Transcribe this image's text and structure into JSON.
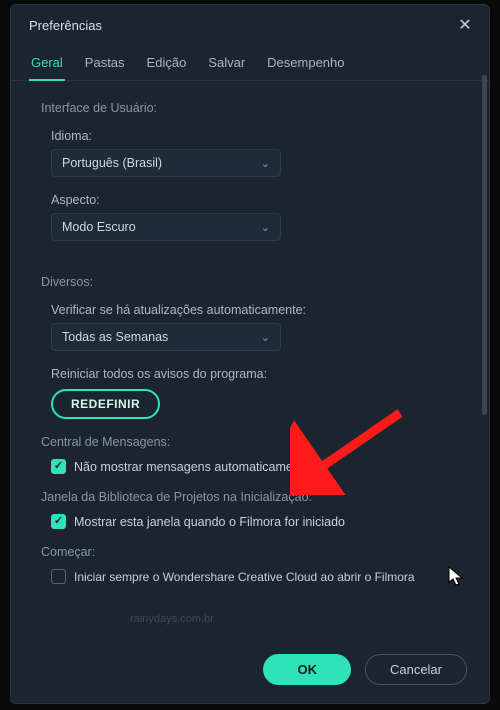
{
  "dialog": {
    "title": "Preferências",
    "tabs": [
      "Geral",
      "Pastas",
      "Edição",
      "Salvar",
      "Desempenho"
    ],
    "active_tab": 0
  },
  "ui_section": {
    "heading": "Interface de Usuário:",
    "language_label": "Idioma:",
    "language_value": "Português (Brasil)",
    "aspect_label": "Aspecto:",
    "aspect_value": "Modo Escuro"
  },
  "misc_section": {
    "heading": "Diversos:",
    "update_label": "Verificar se há atualizações automaticamente:",
    "update_value": "Todas as Semanas",
    "reset_label": "Reiniciar todos os avisos do programa:",
    "reset_button": "REDEFINIR",
    "msgcenter_label": "Central de Mensagens:",
    "msgcenter_check": "Não mostrar mensagens automaticamente",
    "library_label": "Janela da Biblioteca de Projetos na Inicialização:",
    "library_check": "Mostrar esta janela quando o Filmora for iniciado",
    "start_label": "Começar:",
    "start_check": "Iniciar sempre o Wondershare Creative Cloud ao abrir o Filmora"
  },
  "footer": {
    "ok": "OK",
    "cancel": "Cancelar"
  },
  "watermark": "rainydays.com.br"
}
